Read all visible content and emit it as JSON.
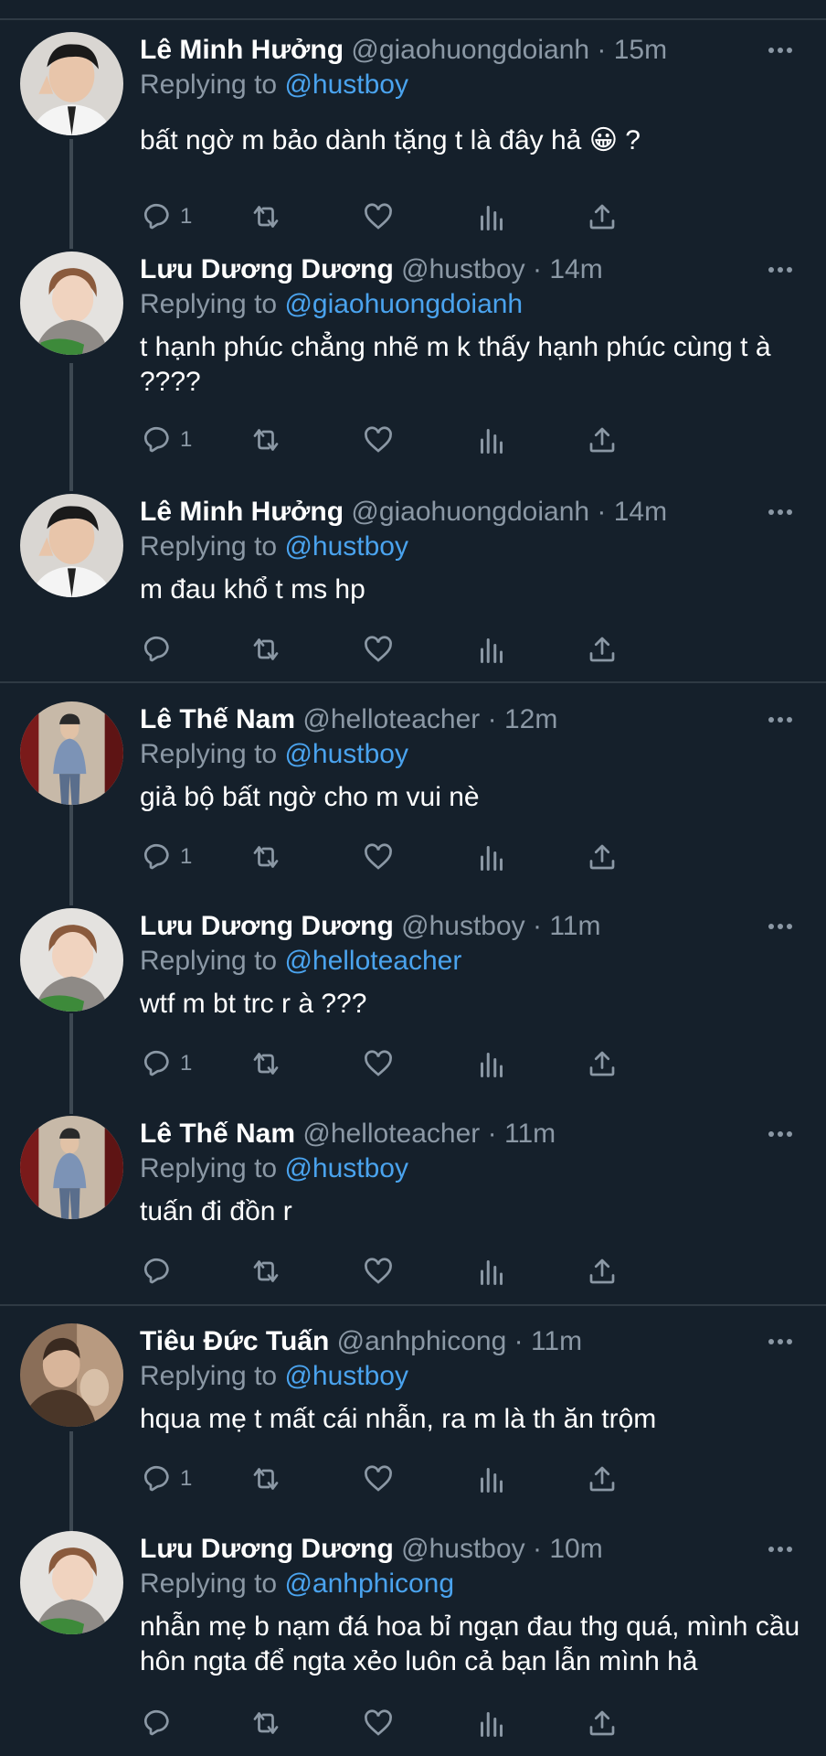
{
  "theme": {
    "background": "#15202b",
    "text": "#ffffff",
    "muted": "#8b98a5",
    "link": "#4aa3ee",
    "divider": "#2f3a44"
  },
  "reply_prefix": "Replying to ",
  "tweets": [
    {
      "name": "Lê Minh Hưởng",
      "handle": "@giaohuongdoianh",
      "time": "15m",
      "reply_to": "@hustboy",
      "text": "bất ngờ m bảo dành tặng t là đây hả 😀 ?",
      "reply_count": "1",
      "avatar": "avatar-minh-huong"
    },
    {
      "name": "Lưu Dương Dương",
      "handle": "@hustboy",
      "time": "14m",
      "reply_to": "@giaohuongdoianh",
      "text": "t hạnh phúc chẳng nhẽ m k thấy hạnh phúc cùng t à ????",
      "reply_count": "1",
      "avatar": "avatar-duong-duong"
    },
    {
      "name": "Lê Minh Hưởng",
      "handle": "@giaohuongdoianh",
      "time": "14m",
      "reply_to": "@hustboy",
      "text": "m đau khổ t ms hp",
      "reply_count": "",
      "avatar": "avatar-minh-huong"
    },
    {
      "name": "Lê Thế Nam",
      "handle": "@helloteacher",
      "time": "12m",
      "reply_to": "@hustboy",
      "text": "giả bộ bất ngờ cho m vui nè",
      "reply_count": "1",
      "avatar": "avatar-the-nam"
    },
    {
      "name": "Lưu Dương Dương",
      "handle": "@hustboy",
      "time": "11m",
      "reply_to": "@helloteacher",
      "text": "wtf m bt trc r à ???",
      "reply_count": "1",
      "avatar": "avatar-duong-duong"
    },
    {
      "name": "Lê Thế Nam",
      "handle": "@helloteacher",
      "time": "11m",
      "reply_to": "@hustboy",
      "text": "tuấn đi đồn r",
      "reply_count": "",
      "avatar": "avatar-the-nam"
    },
    {
      "name": "Tiêu Đức Tuấn",
      "handle": "@anhphicong",
      "time": "11m",
      "reply_to": "@hustboy",
      "text": "hqua mẹ t mất cái nhẫn, ra m là th ăn trộm",
      "reply_count": "1",
      "avatar": "avatar-duc-tuan"
    },
    {
      "name": "Lưu Dương Dương",
      "handle": "@hustboy",
      "time": "10m",
      "reply_to": "@anhphicong",
      "text": "nhẫn mẹ b nạm đá hoa bỉ ngạn đau thg quá, mình cầu hôn ngta để ngta xẻo luôn cả bạn lẫn mình hả",
      "reply_count": "",
      "avatar": "avatar-duong-duong"
    }
  ]
}
